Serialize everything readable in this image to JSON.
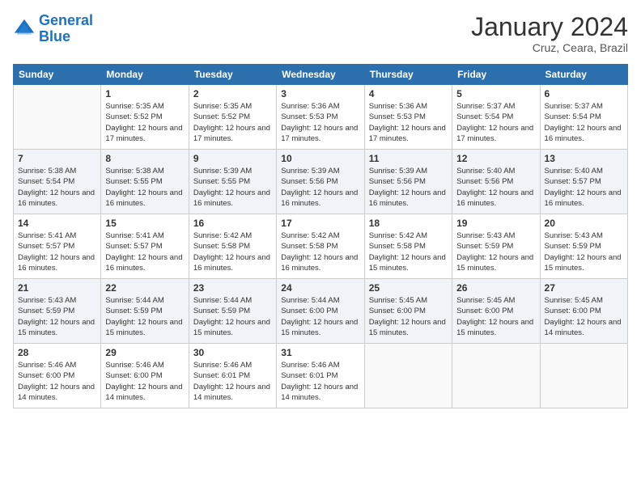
{
  "header": {
    "logo_line1": "General",
    "logo_line2": "Blue",
    "main_title": "January 2024",
    "subtitle": "Cruz, Ceara, Brazil"
  },
  "calendar": {
    "days_of_week": [
      "Sunday",
      "Monday",
      "Tuesday",
      "Wednesday",
      "Thursday",
      "Friday",
      "Saturday"
    ],
    "weeks": [
      [
        {
          "day": "",
          "info": ""
        },
        {
          "day": "1",
          "info": "Sunrise: 5:35 AM\nSunset: 5:52 PM\nDaylight: 12 hours and 17 minutes."
        },
        {
          "day": "2",
          "info": "Sunrise: 5:35 AM\nSunset: 5:52 PM\nDaylight: 12 hours and 17 minutes."
        },
        {
          "day": "3",
          "info": "Sunrise: 5:36 AM\nSunset: 5:53 PM\nDaylight: 12 hours and 17 minutes."
        },
        {
          "day": "4",
          "info": "Sunrise: 5:36 AM\nSunset: 5:53 PM\nDaylight: 12 hours and 17 minutes."
        },
        {
          "day": "5",
          "info": "Sunrise: 5:37 AM\nSunset: 5:54 PM\nDaylight: 12 hours and 17 minutes."
        },
        {
          "day": "6",
          "info": "Sunrise: 5:37 AM\nSunset: 5:54 PM\nDaylight: 12 hours and 16 minutes."
        }
      ],
      [
        {
          "day": "7",
          "info": "Sunrise: 5:38 AM\nSunset: 5:54 PM\nDaylight: 12 hours and 16 minutes."
        },
        {
          "day": "8",
          "info": "Sunrise: 5:38 AM\nSunset: 5:55 PM\nDaylight: 12 hours and 16 minutes."
        },
        {
          "day": "9",
          "info": "Sunrise: 5:39 AM\nSunset: 5:55 PM\nDaylight: 12 hours and 16 minutes."
        },
        {
          "day": "10",
          "info": "Sunrise: 5:39 AM\nSunset: 5:56 PM\nDaylight: 12 hours and 16 minutes."
        },
        {
          "day": "11",
          "info": "Sunrise: 5:39 AM\nSunset: 5:56 PM\nDaylight: 12 hours and 16 minutes."
        },
        {
          "day": "12",
          "info": "Sunrise: 5:40 AM\nSunset: 5:56 PM\nDaylight: 12 hours and 16 minutes."
        },
        {
          "day": "13",
          "info": "Sunrise: 5:40 AM\nSunset: 5:57 PM\nDaylight: 12 hours and 16 minutes."
        }
      ],
      [
        {
          "day": "14",
          "info": "Sunrise: 5:41 AM\nSunset: 5:57 PM\nDaylight: 12 hours and 16 minutes."
        },
        {
          "day": "15",
          "info": "Sunrise: 5:41 AM\nSunset: 5:57 PM\nDaylight: 12 hours and 16 minutes."
        },
        {
          "day": "16",
          "info": "Sunrise: 5:42 AM\nSunset: 5:58 PM\nDaylight: 12 hours and 16 minutes."
        },
        {
          "day": "17",
          "info": "Sunrise: 5:42 AM\nSunset: 5:58 PM\nDaylight: 12 hours and 16 minutes."
        },
        {
          "day": "18",
          "info": "Sunrise: 5:42 AM\nSunset: 5:58 PM\nDaylight: 12 hours and 15 minutes."
        },
        {
          "day": "19",
          "info": "Sunrise: 5:43 AM\nSunset: 5:59 PM\nDaylight: 12 hours and 15 minutes."
        },
        {
          "day": "20",
          "info": "Sunrise: 5:43 AM\nSunset: 5:59 PM\nDaylight: 12 hours and 15 minutes."
        }
      ],
      [
        {
          "day": "21",
          "info": "Sunrise: 5:43 AM\nSunset: 5:59 PM\nDaylight: 12 hours and 15 minutes."
        },
        {
          "day": "22",
          "info": "Sunrise: 5:44 AM\nSunset: 5:59 PM\nDaylight: 12 hours and 15 minutes."
        },
        {
          "day": "23",
          "info": "Sunrise: 5:44 AM\nSunset: 5:59 PM\nDaylight: 12 hours and 15 minutes."
        },
        {
          "day": "24",
          "info": "Sunrise: 5:44 AM\nSunset: 6:00 PM\nDaylight: 12 hours and 15 minutes."
        },
        {
          "day": "25",
          "info": "Sunrise: 5:45 AM\nSunset: 6:00 PM\nDaylight: 12 hours and 15 minutes."
        },
        {
          "day": "26",
          "info": "Sunrise: 5:45 AM\nSunset: 6:00 PM\nDaylight: 12 hours and 15 minutes."
        },
        {
          "day": "27",
          "info": "Sunrise: 5:45 AM\nSunset: 6:00 PM\nDaylight: 12 hours and 14 minutes."
        }
      ],
      [
        {
          "day": "28",
          "info": "Sunrise: 5:46 AM\nSunset: 6:00 PM\nDaylight: 12 hours and 14 minutes."
        },
        {
          "day": "29",
          "info": "Sunrise: 5:46 AM\nSunset: 6:00 PM\nDaylight: 12 hours and 14 minutes."
        },
        {
          "day": "30",
          "info": "Sunrise: 5:46 AM\nSunset: 6:01 PM\nDaylight: 12 hours and 14 minutes."
        },
        {
          "day": "31",
          "info": "Sunrise: 5:46 AM\nSunset: 6:01 PM\nDaylight: 12 hours and 14 minutes."
        },
        {
          "day": "",
          "info": ""
        },
        {
          "day": "",
          "info": ""
        },
        {
          "day": "",
          "info": ""
        }
      ]
    ]
  }
}
